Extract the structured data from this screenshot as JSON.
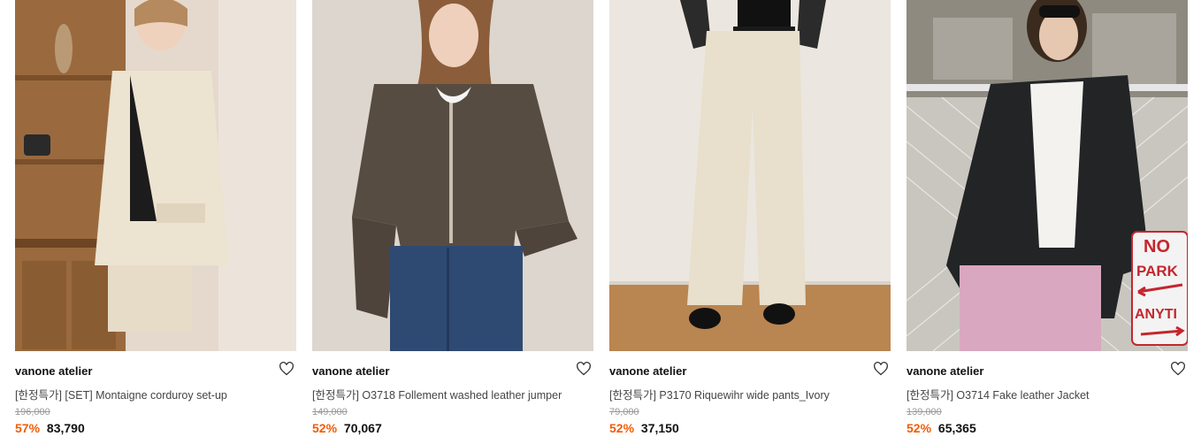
{
  "products": [
    {
      "brand": "vanone atelier",
      "title": "[한정특가] [SET] Montaigne corduroy set-up",
      "original_price": "196,000",
      "discount": "57%",
      "price": "83,790",
      "liked": false
    },
    {
      "brand": "vanone atelier",
      "title": "[한정특가] O3718 Follement washed leather jumper",
      "original_price": "149,000",
      "discount": "52%",
      "price": "70,067",
      "liked": false
    },
    {
      "brand": "vanone atelier",
      "title": "[한정특가] P3170 Riquewihr wide pants_Ivory",
      "original_price": "79,000",
      "discount": "52%",
      "price": "37,150",
      "liked": false
    },
    {
      "brand": "vanone atelier",
      "title": "[한정특가] O3714 Fake leather Jacket",
      "original_price": "139,000",
      "discount": "52%",
      "price": "65,365",
      "liked": false
    }
  ],
  "colors": {
    "discount": "#f25c05",
    "strikethrough": "#999999"
  },
  "icons": {
    "wishlist": "heart-outline-icon"
  },
  "sign_text": {
    "line1": "NO",
    "line2": "PARK",
    "line3": "ANYTI"
  }
}
